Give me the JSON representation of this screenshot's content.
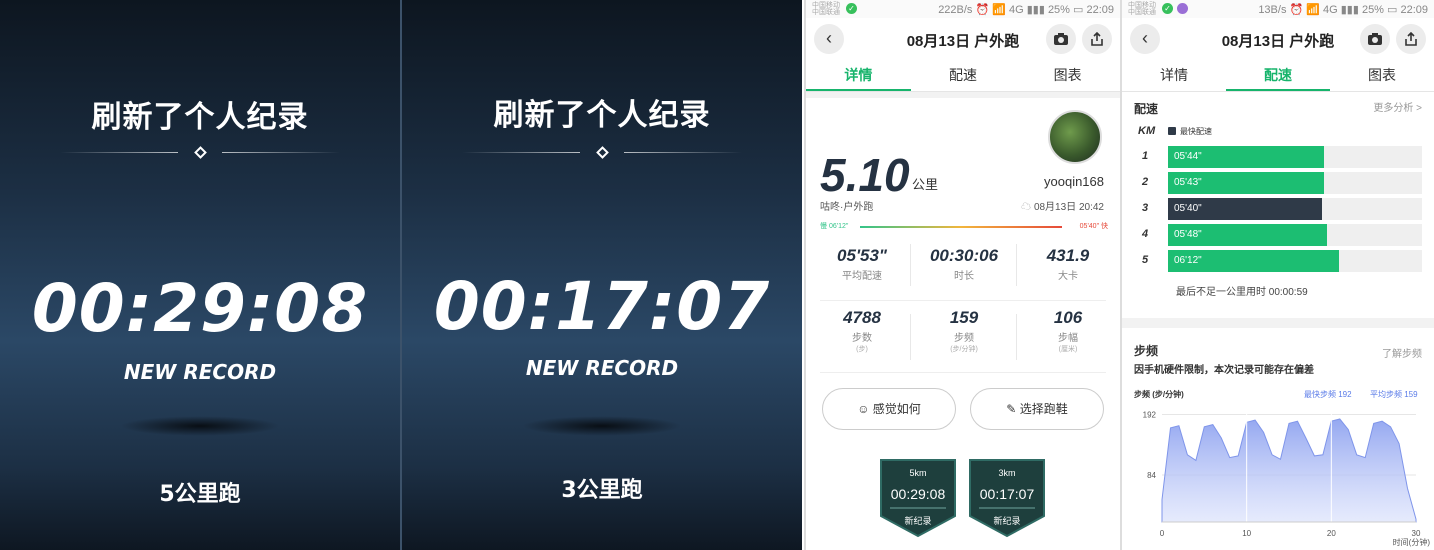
{
  "record_cards": [
    {
      "title": "刷新了个人纪录",
      "time": "00:29:08",
      "badge": "NEW RECORD",
      "distance": "5公里跑"
    },
    {
      "title": "刷新了个人纪录",
      "time": "00:17:07",
      "badge": "NEW RECORD",
      "distance": "3公里跑"
    }
  ],
  "detail_screen": {
    "status": {
      "carrier": "中国移动\n中国联通",
      "right": "222B/s ⏰ 📶 4G ▮▮▮ 25% ▭ 22:09"
    },
    "nav_title": "08月13日 户外跑",
    "tabs": [
      "详情",
      "配速",
      "图表"
    ],
    "active_tab": 0,
    "distance_value": "5.10",
    "distance_unit": "公里",
    "run_type": "咕咚·户外跑",
    "username": "yooqin168",
    "datetime": "08月13日 20:42",
    "slow_label": "慢 06'12\"",
    "fast_label": "05'40\" 快",
    "stats_row1": [
      {
        "value": "05'53\"",
        "label": "平均配速"
      },
      {
        "value": "00:30:06",
        "label": "时长"
      },
      {
        "value": "431.9",
        "label": "大卡"
      }
    ],
    "stats_row2": [
      {
        "value": "4788",
        "label": "步数",
        "sub": "(步)"
      },
      {
        "value": "159",
        "label": "步频",
        "sub": "(步/分钟)"
      },
      {
        "value": "106",
        "label": "步幅",
        "sub": "(厘米)"
      }
    ],
    "btn_feel": "感觉如何",
    "btn_shoes": "选择跑鞋",
    "medals": [
      {
        "dist": "5km",
        "time": "00:29:08",
        "label": "新纪录"
      },
      {
        "dist": "3km",
        "time": "00:17:07",
        "label": "新纪录"
      }
    ]
  },
  "pace_screen": {
    "status": {
      "carrier": "中国移动\n中国联通",
      "right": "13B/s ⏰ 📶 4G ▮▮▮ 25% ▭ 22:09"
    },
    "nav_title": "08月13日 户外跑",
    "tabs": [
      "详情",
      "配速",
      "图表"
    ],
    "active_tab": 1,
    "pace_heading": "配速",
    "more_analysis": "更多分析 >",
    "km_label": "KM",
    "legend_fastest": "最快配速",
    "splits": [
      {
        "km": "1",
        "pace": "05'44\"",
        "fill": 0.62,
        "fastest": false
      },
      {
        "km": "2",
        "pace": "05'43\"",
        "fill": 0.62,
        "fastest": false
      },
      {
        "km": "3",
        "pace": "05'40\"",
        "fill": 0.61,
        "fastest": true
      },
      {
        "km": "4",
        "pace": "05'48\"",
        "fill": 0.63,
        "fastest": false
      },
      {
        "km": "5",
        "pace": "06'12\"",
        "fill": 0.68,
        "fastest": false
      }
    ],
    "leftover": "最后不足一公里用时 00:00:59",
    "cadence_heading": "步频",
    "cadence_link": "了解步频",
    "cadence_note": "因手机硬件限制，本次记录可能存在偏差",
    "cadence_unit": "步频  (步/分钟)",
    "fastest_cadence": "最快步频 192",
    "avg_cadence": "平均步频 159",
    "x_unit": "时间(分钟)"
  },
  "chart_data": {
    "type": "area",
    "ylabel": "步频 (步/分钟)",
    "xlabel": "时间(分钟)",
    "xlim": [
      0,
      30
    ],
    "ylim": [
      0,
      200
    ],
    "yticks": [
      84,
      192
    ],
    "xticks": [
      0,
      10,
      20,
      30
    ],
    "x": [
      0,
      1,
      2,
      3,
      4,
      5,
      6,
      7,
      8,
      9,
      10,
      11,
      12,
      13,
      14,
      15,
      16,
      17,
      18,
      19,
      20,
      21,
      22,
      23,
      24,
      25,
      26,
      27,
      28,
      29,
      30
    ],
    "values": [
      40,
      168,
      172,
      120,
      110,
      170,
      174,
      150,
      115,
      118,
      178,
      182,
      160,
      120,
      112,
      176,
      180,
      150,
      118,
      120,
      180,
      184,
      165,
      120,
      115,
      176,
      180,
      170,
      140,
      60,
      5
    ]
  },
  "colors": {
    "green": "#1cbe72",
    "dark": "#2f3a48",
    "area": "#8fa3f0"
  }
}
